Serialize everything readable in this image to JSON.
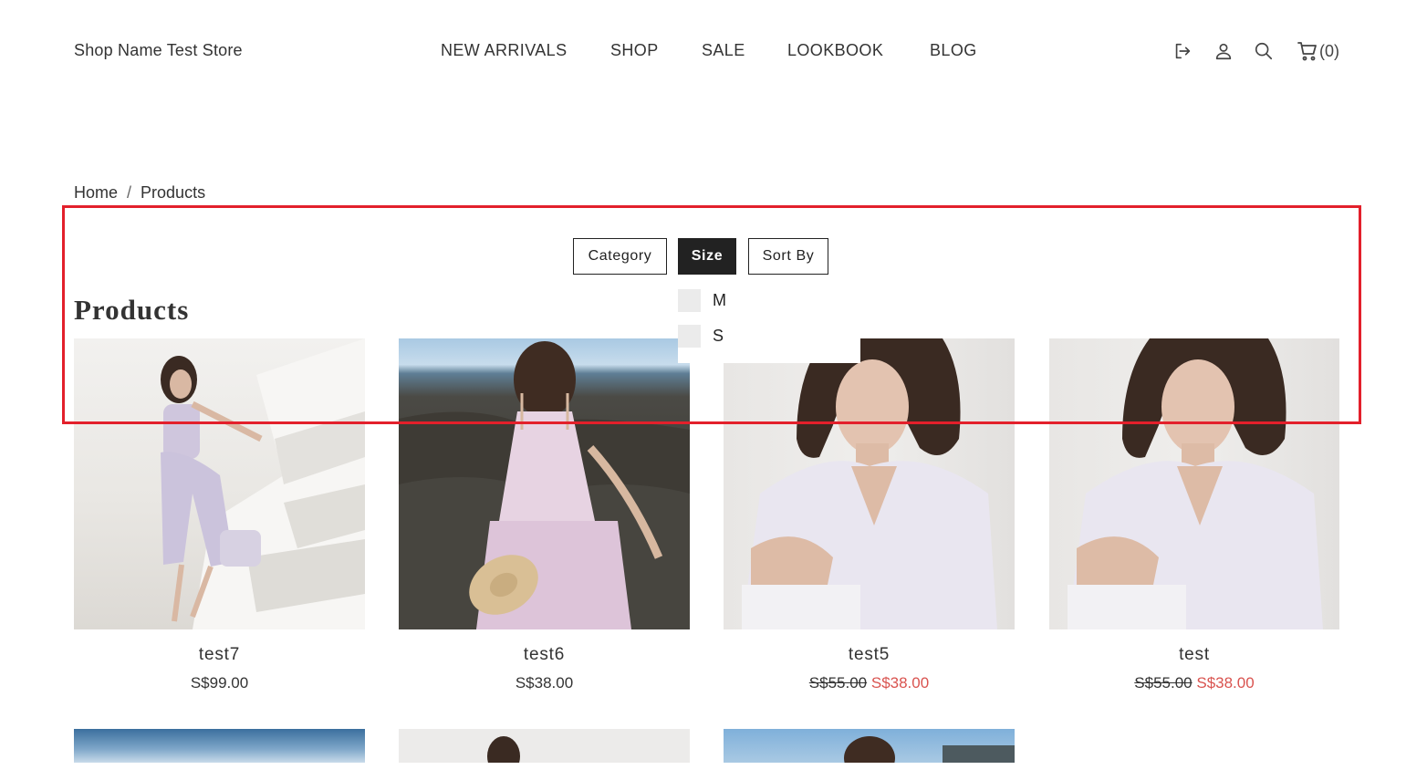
{
  "header": {
    "store_name": "Shop Name Test Store",
    "nav": [
      "NEW ARRIVALS",
      "SHOP",
      "SALE",
      "LOOKBOOK",
      "BLOG"
    ],
    "icons": [
      "logout-icon",
      "user-icon",
      "search-icon",
      "cart-icon"
    ],
    "cart_count": "(0)"
  },
  "breadcrumb": {
    "home": "Home",
    "separator": "/",
    "current": "Products"
  },
  "filters": {
    "category": "Category",
    "size": "Size",
    "sort_by": "Sort By",
    "active": "Size",
    "size_options": [
      "M",
      "S"
    ]
  },
  "page_title": "Products",
  "products": [
    {
      "name": "test7",
      "price": "S$99.00"
    },
    {
      "name": "test6",
      "price": "S$38.00"
    },
    {
      "name": "test5",
      "old_price": "S$55.00",
      "sale_price": "S$38.00"
    },
    {
      "name": "test",
      "old_price": "S$55.00",
      "sale_price": "S$38.00"
    }
  ],
  "colors": {
    "sale": "#d9534f",
    "active_filter_bg": "#222222",
    "highlight": "#e3202b"
  }
}
